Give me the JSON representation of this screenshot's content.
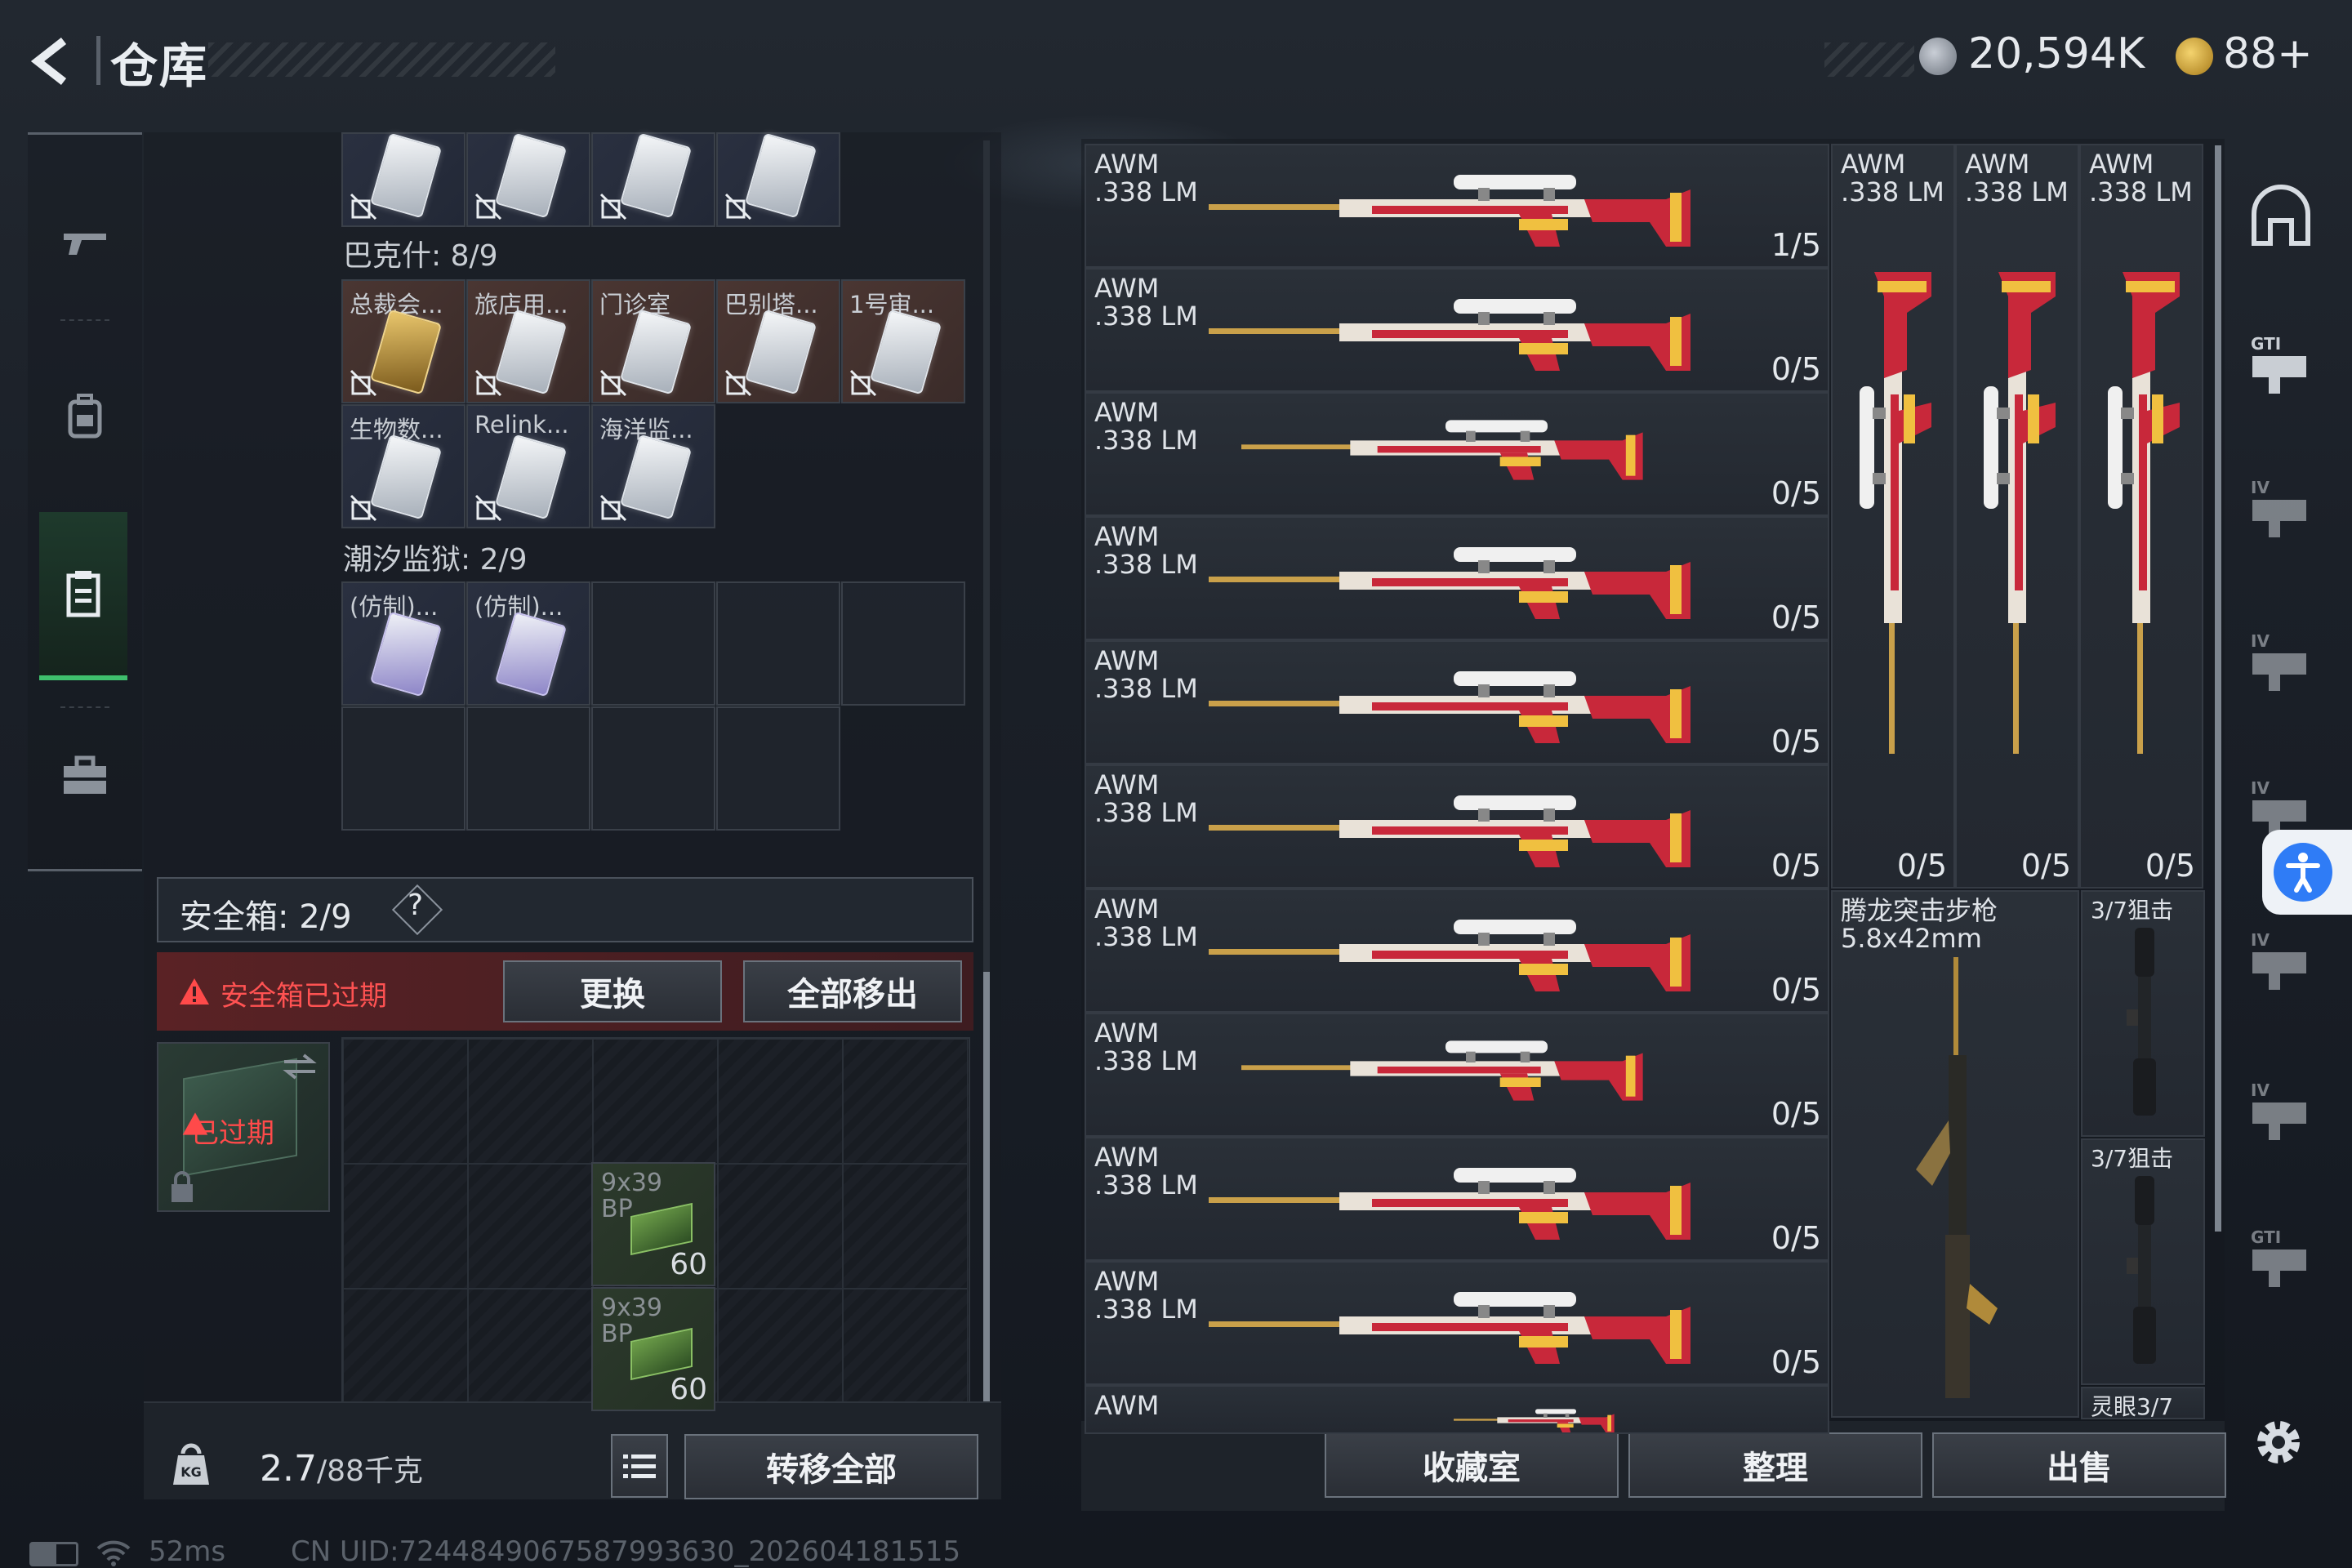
{
  "header": {
    "title": "仓库",
    "currency_silver": "20,594K",
    "currency_gold": "88+"
  },
  "left_nav": {
    "items": [
      "gun-icon",
      "backpack-icon",
      "storage-icon",
      "toolbox-icon"
    ],
    "active": "storage-icon"
  },
  "inventory": {
    "top_row_count": 4,
    "section_bakeshi": {
      "label": "巴克什: 8/9"
    },
    "bakeshi_cards": [
      {
        "label": "总裁会...",
        "style": "gold"
      },
      {
        "label": "旅店用...",
        "style": "white"
      },
      {
        "label": "门诊室",
        "style": "white"
      },
      {
        "label": "巴别塔...",
        "style": "white"
      },
      {
        "label": "1号审...",
        "style": "white"
      },
      {
        "label": "生物数...",
        "style": "white"
      },
      {
        "label": "Relink...",
        "style": "white"
      },
      {
        "label": "海洋监...",
        "style": "white"
      }
    ],
    "section_chaoxi": {
      "label": "潮汐监狱: 2/9"
    },
    "chaoxi_cards": [
      {
        "label": "(仿制)..."
      },
      {
        "label": "(仿制)..."
      }
    ]
  },
  "safe_box": {
    "label": "安全箱: 2/9",
    "help": "?",
    "expired_warning": "安全箱已过期",
    "replace_button": "更换",
    "remove_all_button": "全部移出",
    "box_status": "已过期",
    "ammo": [
      {
        "label": "9x39\nBP",
        "count": "60"
      },
      {
        "label": "9x39\nBP",
        "count": "60"
      }
    ]
  },
  "weight": {
    "current": "2.7",
    "max": "/88千克",
    "transfer_all_button": "转移全部"
  },
  "weapons_list": [
    {
      "name": "AWM\n.338 LM",
      "count": "1/5"
    },
    {
      "name": "AWM\n.338 LM",
      "count": "0/5"
    },
    {
      "name": "AWM\n.338 LM",
      "count": "0/5"
    },
    {
      "name": "AWM\n.338 LM",
      "count": "0/5"
    },
    {
      "name": "AWM\n.338 LM",
      "count": "0/5"
    },
    {
      "name": "AWM\n.338 LM",
      "count": "0/5"
    },
    {
      "name": "AWM\n.338 LM",
      "count": "0/5"
    },
    {
      "name": "AWM\n.338 LM",
      "count": "0/5"
    },
    {
      "name": "AWM\n.338 LM",
      "count": "0/5"
    },
    {
      "name": "AWM\n.338 LM",
      "count": "0/5"
    },
    {
      "name": "AWM",
      "count": ""
    }
  ],
  "vertical_weapons": [
    {
      "name": "AWM\n.338 LM",
      "count": "0/5"
    },
    {
      "name": "AWM\n.338 LM",
      "count": "0/5"
    },
    {
      "name": "AWM\n.338 LM",
      "count": "0/5"
    }
  ],
  "rifle_item": {
    "name": "腾龙突击步枪\n5.8x42mm"
  },
  "scopes": [
    {
      "name": "3/7狙击"
    },
    {
      "name": "3/7狙击"
    },
    {
      "name": "灵眼3/7"
    }
  ],
  "bottom_buttons": {
    "collection": "收藏室",
    "sort": "整理",
    "sell": "出售"
  },
  "right_nav": [
    "home-icon",
    "gti-weapon-icon",
    "iv-weapon-icon",
    "iv-medkit-icon",
    "iv-medkit2-icon",
    "iv-folder-icon",
    "iv-folder2-icon",
    "gti-key-icon"
  ],
  "footer": {
    "ping": "52ms",
    "uid": "CN UID:7244849067587993630_202604181515"
  },
  "colors": {
    "accent_green": "#3fbf6d",
    "warning_red": "#ff4a4a",
    "weapon_red": "#c8283a"
  }
}
